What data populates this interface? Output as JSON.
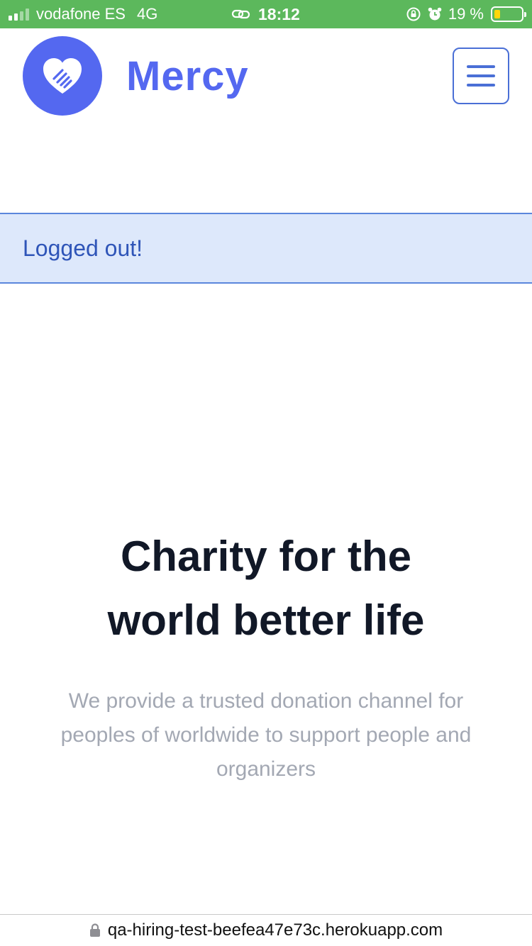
{
  "status_bar": {
    "carrier": "vodafone ES",
    "network": "4G",
    "time": "18:12",
    "battery": "19 %",
    "battery_level": 0.19,
    "signal_bars": 2
  },
  "header": {
    "brand": "Mercy",
    "brand_color": "#5468f0",
    "menu_icon": "hamburger-icon"
  },
  "alert": {
    "message": "Logged out!"
  },
  "hero": {
    "title_line1": "Charity for the",
    "title_line2": "world better life",
    "subtitle": "We provide a trusted donation channel for peoples of worldwide to support people and organizers"
  },
  "browser": {
    "url": "qa-hiring-test-beefea47e73c.herokuapp.com"
  }
}
